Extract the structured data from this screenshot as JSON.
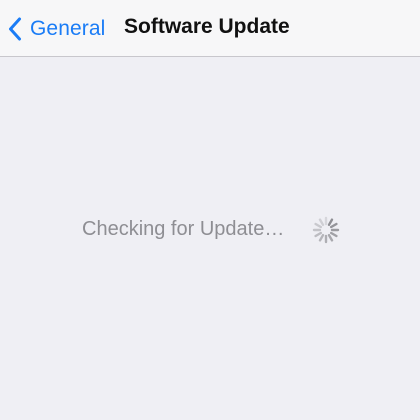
{
  "navbar": {
    "back_label": "General",
    "title": "Software Update",
    "back_icon": "chevron-left-icon"
  },
  "status": {
    "message": "Checking for Update…",
    "spinner_icon": "activity-spinner-icon"
  },
  "colors": {
    "accent": "#1a7cf6",
    "background": "#efeff4",
    "navbar": "#f7f7f8",
    "status_text": "#8e8e93"
  }
}
